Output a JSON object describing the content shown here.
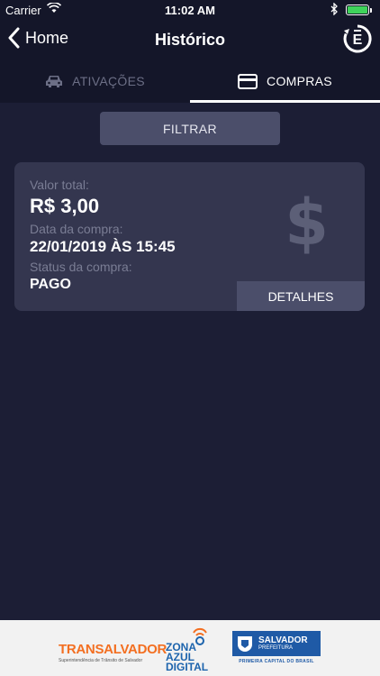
{
  "status_bar": {
    "carrier": "Carrier",
    "time": "11:02 AM",
    "battery_color": "#3fd35b"
  },
  "nav": {
    "back_label": "Home",
    "title": "Histórico",
    "logo_icon": "e-app-logo-icon"
  },
  "tabs": [
    {
      "label": "ATIVAÇÕES",
      "icon": "car-icon",
      "active": false
    },
    {
      "label": "COMPRAS",
      "icon": "credit-card-icon",
      "active": true
    }
  ],
  "filter_button": {
    "label": "FILTRAR"
  },
  "purchase_card": {
    "total_label": "Valor total:",
    "total_value": "R$ 3,00",
    "date_label": "Data da compra:",
    "date_value": "22/01/2019 ÀS 15:45",
    "status_label": "Status da compra:",
    "status_value": "PAGO",
    "details_label": "DETALHES",
    "icon": "dollar-icon"
  },
  "footer": {
    "transalvador_title": "TRANSALVADOR",
    "transalvador_subtitle": "Superintendência de Trânsito de Salvador",
    "zona_line1": "ZONA",
    "zona_line2": "AZUL",
    "zona_line3": "DIGITAL",
    "salvador_title": "SALVADOR",
    "salvador_subtitle": "PREFEITURA",
    "salvador_motto": "PRIMEIRA CAPITAL DO BRASIL"
  },
  "colors": {
    "background": "#1c1e35",
    "bar": "#141629",
    "card": "#34364f",
    "button": "#4b4e6a",
    "transalvador_orange": "#f36f21",
    "salvador_blue": "#1f5aa6"
  }
}
